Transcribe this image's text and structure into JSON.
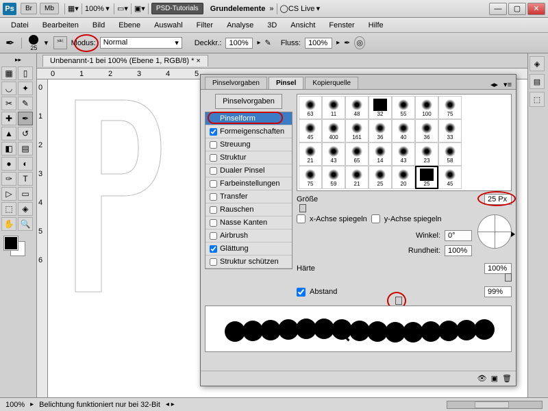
{
  "title": {
    "app": "Ps",
    "br": "Br",
    "mb": "Mb",
    "zoom": "100%",
    "doc_selector": "PSD-Tutorials",
    "layer_set": "Grundelemente",
    "cslive": "CS Live"
  },
  "menu": [
    "Datei",
    "Bearbeiten",
    "Bild",
    "Ebene",
    "Auswahl",
    "Filter",
    "Analyse",
    "3D",
    "Ansicht",
    "Fenster",
    "Hilfe"
  ],
  "optbar": {
    "size_val": "25",
    "mode_label": "Modus:",
    "mode_val": "Normal",
    "opacity_label": "Deckkr.:",
    "opacity_val": "100%",
    "flow_label": "Fluss:",
    "flow_val": "100%"
  },
  "doc_tab": "Unbenannt-1 bei 100% (Ebene 1, RGB/8) *",
  "ruler_h": [
    "0",
    "1",
    "2",
    "3",
    "4",
    "5"
  ],
  "ruler_v": [
    "0",
    "1",
    "2",
    "3",
    "4",
    "5",
    "6"
  ],
  "brush_panel": {
    "tabs": [
      "Pinselvorgaben",
      "Pinsel",
      "Kopierquelle"
    ],
    "preset_btn": "Pinselvorgaben",
    "options": [
      {
        "label": "Pinselform",
        "sel": true,
        "check": null
      },
      {
        "label": "Formeigenschaften",
        "check": true
      },
      {
        "label": "Streuung",
        "check": false
      },
      {
        "label": "Struktur",
        "check": false
      },
      {
        "label": "Dualer Pinsel",
        "check": false
      },
      {
        "label": "Farbeinstellungen",
        "check": false
      },
      {
        "label": "Transfer",
        "check": false
      },
      {
        "label": "Rauschen",
        "check": false
      },
      {
        "label": "Nasse Kanten",
        "check": false
      },
      {
        "label": "Airbrush",
        "check": false
      },
      {
        "label": "Glättung",
        "check": true
      },
      {
        "label": "Struktur schützen",
        "check": false
      }
    ],
    "grid": [
      [
        "63",
        "11",
        "48",
        "32",
        "55",
        "100",
        "75"
      ],
      [
        "45",
        "400",
        "161",
        "36",
        "40",
        "36",
        "33"
      ],
      [
        "21",
        "43",
        "65",
        "14",
        "43",
        "23",
        "58"
      ],
      [
        "75",
        "59",
        "21",
        "25",
        "20",
        "25",
        "45"
      ]
    ],
    "size_label": "Größe",
    "size_val": "25 Px",
    "flip_x": "x-Achse spiegeln",
    "flip_y": "y-Achse spiegeln",
    "angle_label": "Winkel:",
    "angle_val": "0°",
    "round_label": "Rundheit:",
    "round_val": "100%",
    "hard_label": "Härte",
    "hard_val": "100%",
    "spacing_label": "Abstand",
    "spacing_val": "99%"
  },
  "status": {
    "zoom": "100%",
    "info": "Belichtung funktioniert nur bei 32-Bit"
  }
}
